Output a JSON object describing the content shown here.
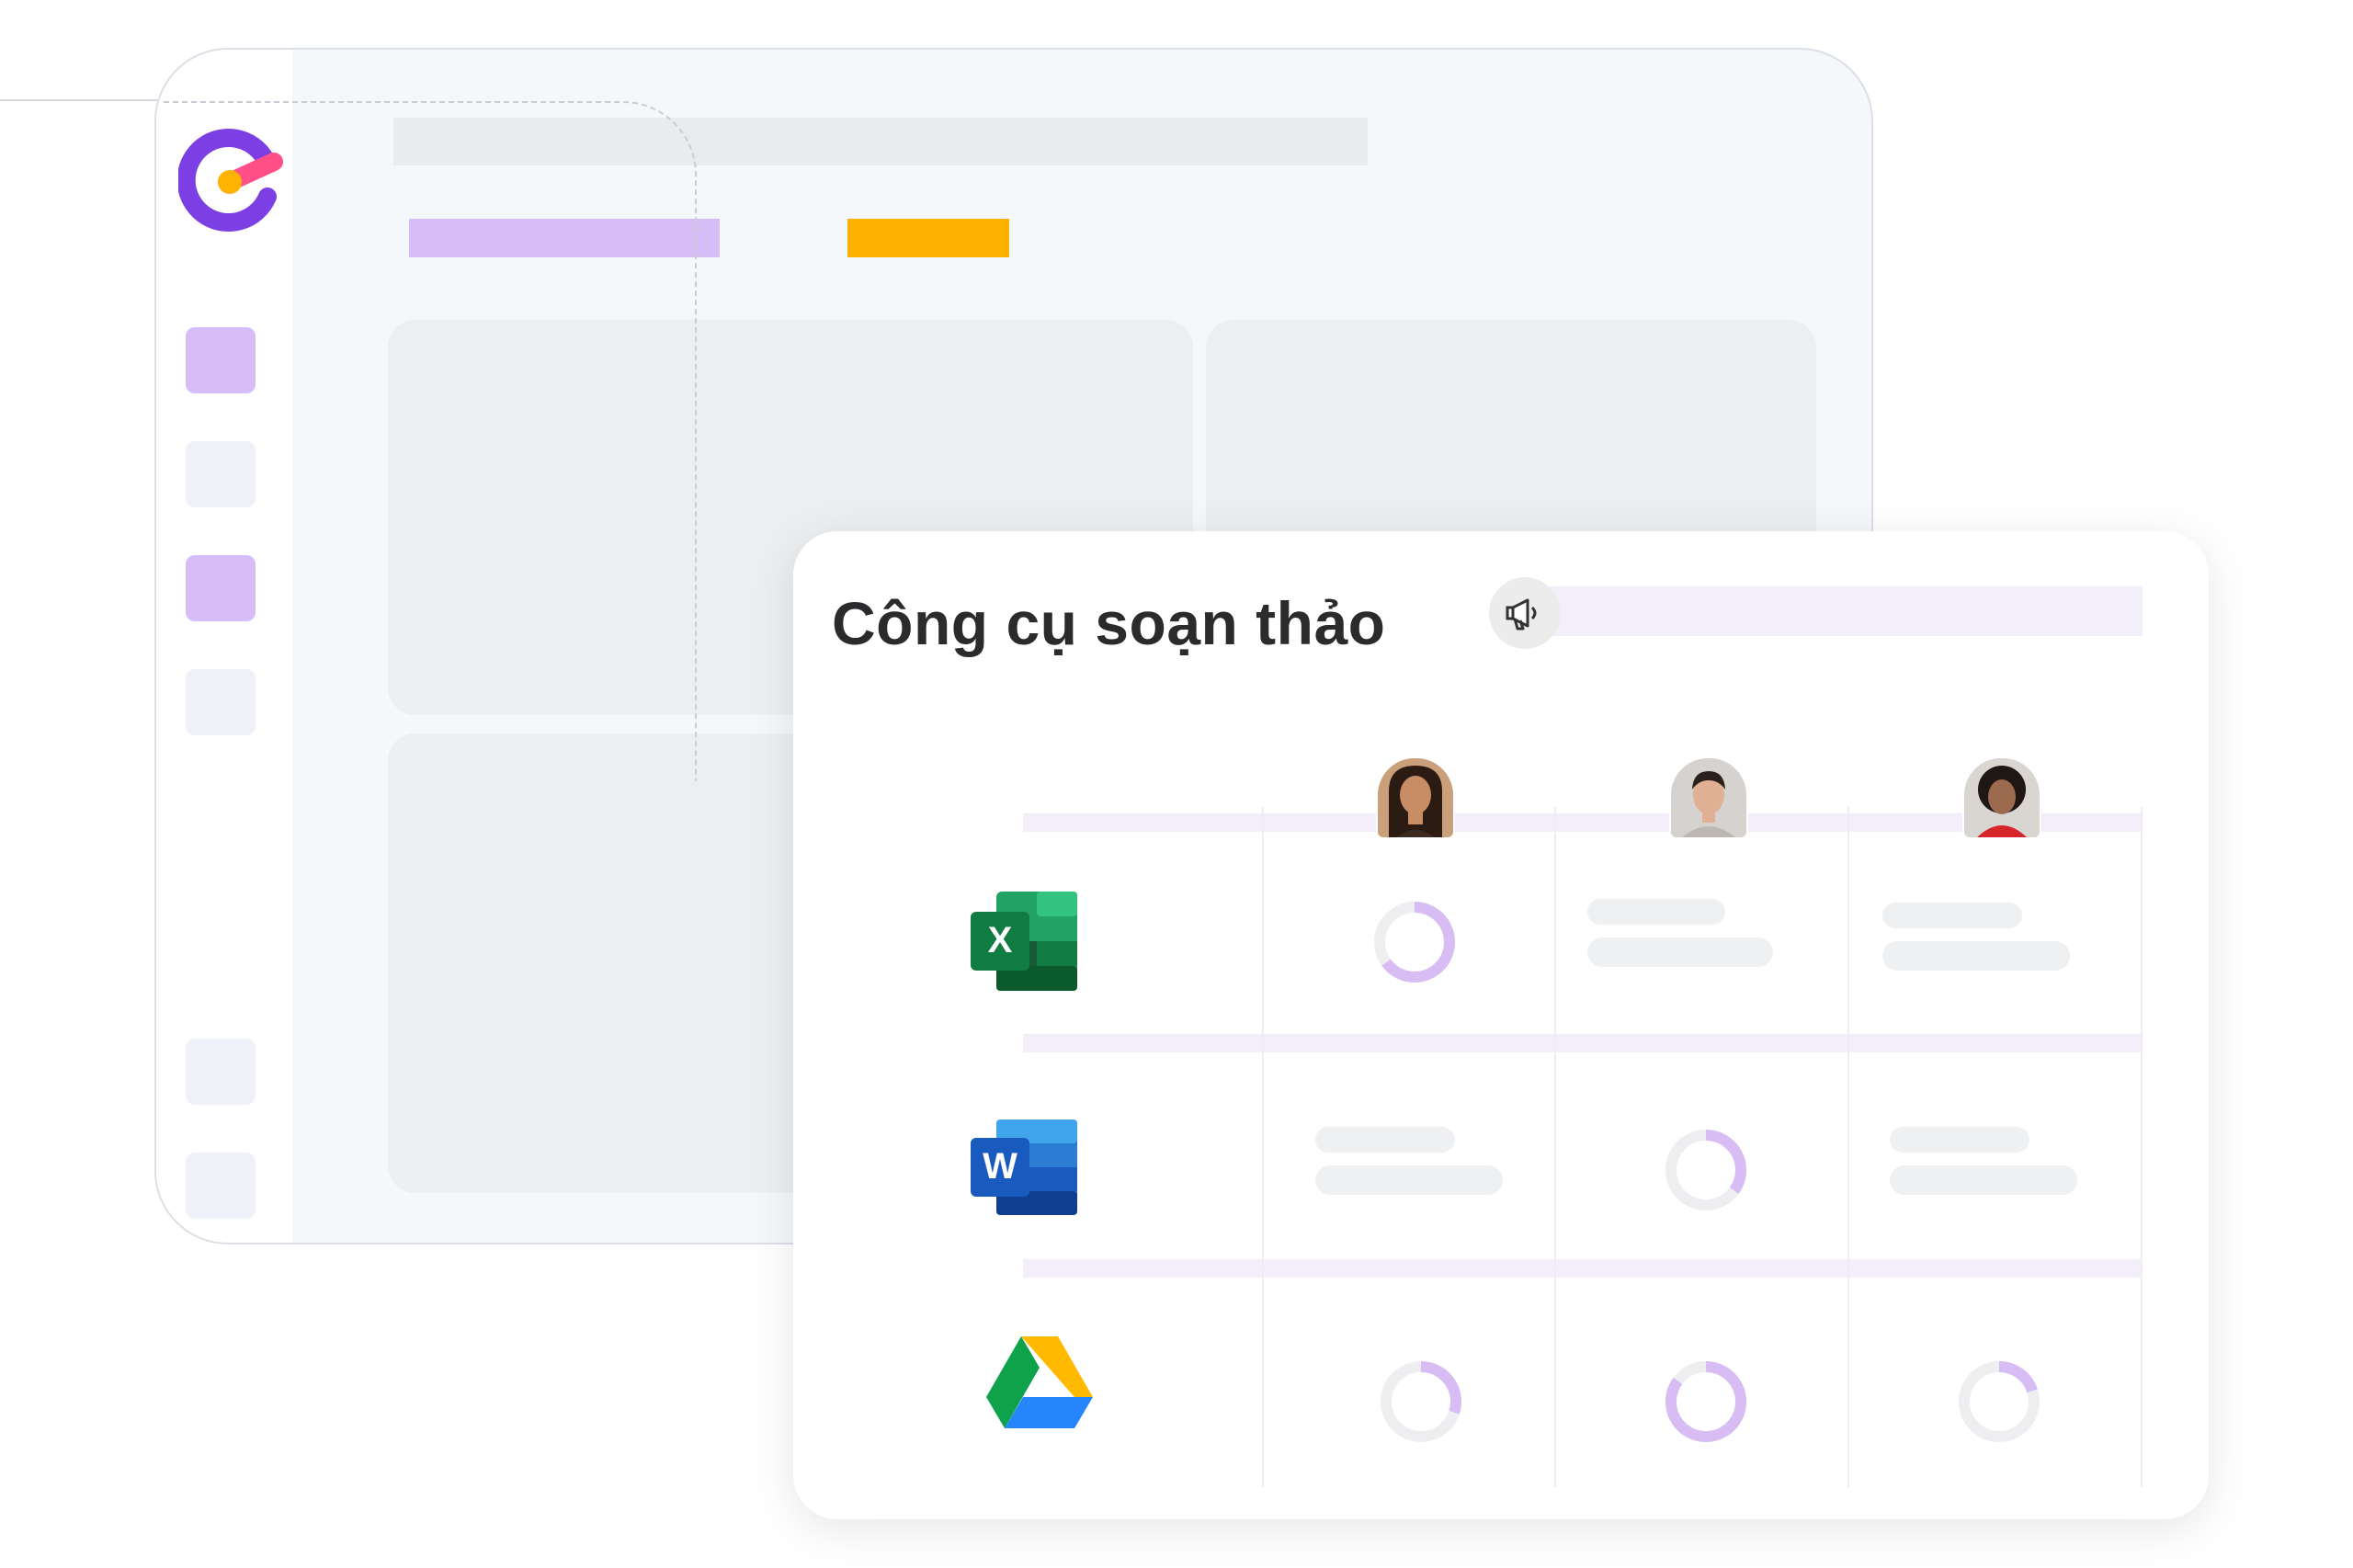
{
  "card": {
    "title": "Công cụ soạn thảo"
  },
  "apps": [
    {
      "name": "Microsoft Excel",
      "icon": "excel-icon",
      "letter": "X"
    },
    {
      "name": "Microsoft Word",
      "icon": "word-icon",
      "letter": "W"
    },
    {
      "name": "Google Drive",
      "icon": "google-drive-icon"
    }
  ],
  "users": [
    {
      "avatar": "avatar-woman-long-hair"
    },
    {
      "avatar": "avatar-man-short-hair"
    },
    {
      "avatar": "avatar-woman-curly-hair"
    }
  ],
  "progress_rings": [
    {
      "app": "excel",
      "user": 1,
      "value": 0.65
    },
    {
      "app": "word",
      "user": 2,
      "value": 0.35
    },
    {
      "app": "drive",
      "user": 1,
      "value": 0.3
    },
    {
      "app": "drive",
      "user": 2,
      "value": 0.85
    },
    {
      "app": "drive",
      "user": 3,
      "value": 0.2
    }
  ],
  "colors": {
    "brand_purple": "#7b3fe4",
    "brand_pink": "#ff4f86",
    "brand_orange": "#ffb300",
    "accent_lavender": "#d6b8f7",
    "ring_track": "#eeeef1",
    "ring_fill": "#d8bdf4",
    "accent_orange_bar": "#fdb200"
  }
}
